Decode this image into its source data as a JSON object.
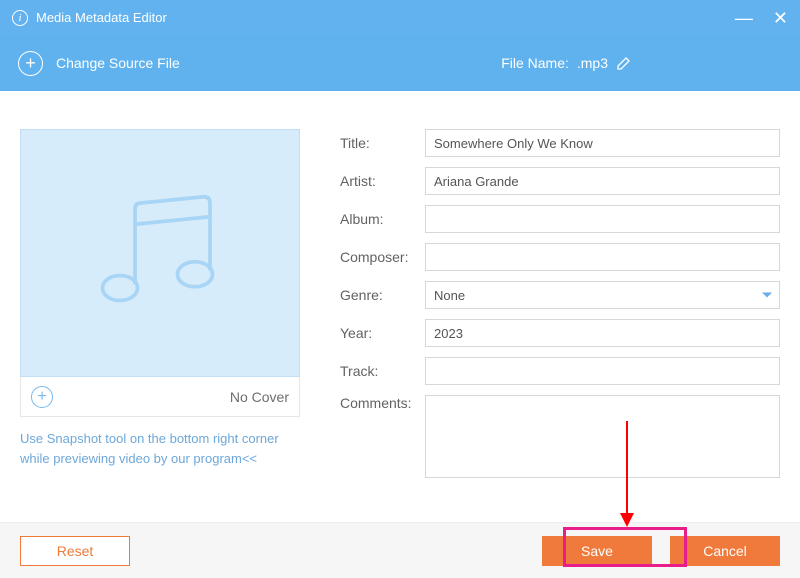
{
  "titlebar": {
    "title": "Media Metadata Editor"
  },
  "toolbar": {
    "change_source": "Change Source File",
    "file_name_label": "File Name:",
    "file_name_value": ".mp3"
  },
  "cover": {
    "no_cover": "No Cover"
  },
  "hint": "Use Snapshot tool on the bottom right corner while previewing video by our program<<",
  "fields": {
    "title": {
      "label": "Title:",
      "value": "Somewhere Only We Know"
    },
    "artist": {
      "label": "Artist:",
      "value": "Ariana Grande"
    },
    "album": {
      "label": "Album:",
      "value": ""
    },
    "composer": {
      "label": "Composer:",
      "value": ""
    },
    "genre": {
      "label": "Genre:",
      "value": "None"
    },
    "year": {
      "label": "Year:",
      "value": "2023"
    },
    "track": {
      "label": "Track:",
      "value": ""
    },
    "comments": {
      "label": "Comments:",
      "value": ""
    }
  },
  "buttons": {
    "reset": "Reset",
    "save": "Save",
    "cancel": "Cancel"
  }
}
